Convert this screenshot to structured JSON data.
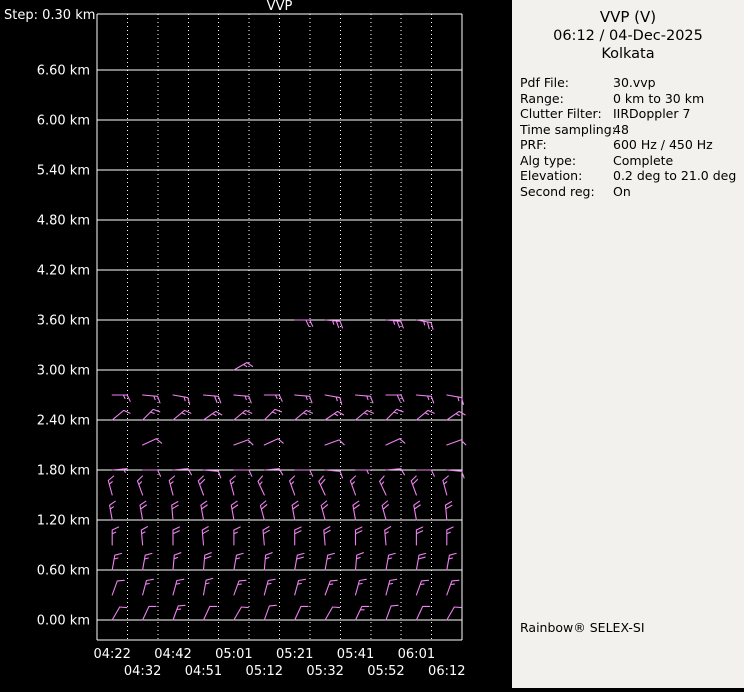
{
  "panel": {
    "title": "VVP (V)",
    "datetime": "06:12 / 04-Dec-2025",
    "site": "Kolkata",
    "params": [
      {
        "label": "Pdf File:",
        "value": "30.vvp"
      },
      {
        "label": "Range:",
        "value": "0 km to 30 km"
      },
      {
        "label": "Clutter Filter:",
        "value": "IIRDoppler 7"
      },
      {
        "label": "Time sampling:",
        "value": "48"
      },
      {
        "label": "PRF:",
        "value": "600 Hz / 450 Hz"
      },
      {
        "label": "Alg type:",
        "value": "Complete"
      },
      {
        "label": "Elevation:",
        "value": "0.2 deg to 21.0 deg"
      },
      {
        "label": "Second reg:",
        "value": "On"
      }
    ],
    "footer": "Rainbow® SELEX-SI"
  },
  "colors": {
    "chart_background": "#000000",
    "panel_background": "#f2f1ee",
    "grid": "#ffffff",
    "axis_text": "#ffffff",
    "barb": "#ee82ee",
    "panel_text": "#000000"
  },
  "chart_data": {
    "type": "scatter",
    "subtype": "wind-barb time-height profile (VVP)",
    "title": "VVP",
    "step_label": "Step: 0.30 km",
    "x_tick_labels": [
      "04:22",
      "04:32",
      "04:42",
      "04:51",
      "05:01",
      "05:12",
      "05:21",
      "05:32",
      "05:41",
      "05:52",
      "06:01",
      "06:12"
    ],
    "y_tick_labels": [
      "0.00 km",
      "0.60 km",
      "1.20 km",
      "1.80 km",
      "2.40 km",
      "3.00 km",
      "3.60 km",
      "4.20 km",
      "4.80 km",
      "5.40 km",
      "6.00 km",
      "6.60 km"
    ],
    "y_tick_values_km": [
      0,
      0.6,
      1.2,
      1.8,
      2.4,
      3.0,
      3.6,
      4.2,
      4.8,
      5.4,
      6.0,
      6.6
    ],
    "y_step_km": 0.3,
    "y_range_km": [
      -0.25,
      7.25
    ],
    "grid": true,
    "legend": "none",
    "background": "#000000",
    "grid_color": "#ffffff",
    "barb_color": "#ee82ee",
    "barb_note": "entries are [time_index, height_km, wind_from_direction_deg, speed_kt]; values estimated from plotted barbs",
    "barbs": [
      [
        0,
        0,
        30,
        10
      ],
      [
        0,
        0.3,
        20,
        10
      ],
      [
        0,
        0.6,
        10,
        15
      ],
      [
        0,
        0.9,
        0,
        15
      ],
      [
        0,
        1.2,
        350,
        15
      ],
      [
        0,
        1.5,
        345,
        15
      ],
      [
        0,
        1.8,
        85,
        5
      ],
      [
        0,
        2.4,
        50,
        10
      ],
      [
        0,
        2.7,
        90,
        15
      ],
      [
        1,
        0,
        25,
        10
      ],
      [
        1,
        0.3,
        15,
        15
      ],
      [
        1,
        0.6,
        10,
        15
      ],
      [
        1,
        0.9,
        355,
        15
      ],
      [
        1,
        1.2,
        350,
        20
      ],
      [
        1,
        1.5,
        340,
        15
      ],
      [
        1,
        1.8,
        90,
        10
      ],
      [
        1,
        2.1,
        65,
        10
      ],
      [
        1,
        2.4,
        45,
        15
      ],
      [
        1,
        2.7,
        95,
        15
      ],
      [
        2,
        0,
        20,
        15
      ],
      [
        2,
        0.3,
        15,
        15
      ],
      [
        2,
        0.6,
        5,
        15
      ],
      [
        2,
        0.9,
        0,
        20
      ],
      [
        2,
        1.2,
        355,
        20
      ],
      [
        2,
        1.5,
        345,
        15
      ],
      [
        2,
        1.8,
        85,
        10
      ],
      [
        2,
        2.4,
        50,
        15
      ],
      [
        2,
        2.7,
        100,
        15
      ],
      [
        3,
        0,
        25,
        10
      ],
      [
        3,
        0.3,
        10,
        15
      ],
      [
        3,
        0.6,
        5,
        20
      ],
      [
        3,
        0.9,
        355,
        20
      ],
      [
        3,
        1.2,
        350,
        20
      ],
      [
        3,
        1.5,
        340,
        20
      ],
      [
        3,
        1.8,
        95,
        10
      ],
      [
        3,
        2.4,
        55,
        15
      ],
      [
        3,
        2.7,
        95,
        20
      ],
      [
        4,
        0,
        30,
        10
      ],
      [
        4,
        0.3,
        20,
        15
      ],
      [
        4,
        0.6,
        10,
        15
      ],
      [
        4,
        0.9,
        0,
        15
      ],
      [
        4,
        1.2,
        350,
        20
      ],
      [
        4,
        1.5,
        345,
        15
      ],
      [
        4,
        1.8,
        90,
        10
      ],
      [
        4,
        2.1,
        70,
        10
      ],
      [
        4,
        2.4,
        50,
        15
      ],
      [
        4,
        2.7,
        95,
        15
      ],
      [
        4,
        3,
        60,
        15
      ],
      [
        5,
        0,
        20,
        10
      ],
      [
        5,
        0.3,
        15,
        15
      ],
      [
        5,
        0.6,
        5,
        15
      ],
      [
        5,
        0.9,
        355,
        20
      ],
      [
        5,
        1.2,
        345,
        20
      ],
      [
        5,
        1.5,
        335,
        15
      ],
      [
        5,
        1.8,
        85,
        10
      ],
      [
        5,
        2.1,
        65,
        10
      ],
      [
        5,
        2.4,
        45,
        15
      ],
      [
        5,
        2.7,
        90,
        15
      ],
      [
        6,
        0,
        25,
        10
      ],
      [
        6,
        0.3,
        15,
        15
      ],
      [
        6,
        0.6,
        10,
        20
      ],
      [
        6,
        0.9,
        0,
        20
      ],
      [
        6,
        1.2,
        350,
        20
      ],
      [
        6,
        1.5,
        340,
        15
      ],
      [
        6,
        1.8,
        90,
        10
      ],
      [
        6,
        2.4,
        50,
        15
      ],
      [
        6,
        2.7,
        95,
        15
      ],
      [
        6,
        3.6,
        90,
        20
      ],
      [
        7,
        0,
        30,
        10
      ],
      [
        7,
        0.3,
        20,
        15
      ],
      [
        7,
        0.6,
        10,
        15
      ],
      [
        7,
        0.9,
        355,
        20
      ],
      [
        7,
        1.2,
        345,
        20
      ],
      [
        7,
        1.5,
        335,
        20
      ],
      [
        7,
        1.8,
        95,
        10
      ],
      [
        7,
        2.1,
        70,
        10
      ],
      [
        7,
        2.4,
        55,
        15
      ],
      [
        7,
        2.7,
        100,
        15
      ],
      [
        7,
        3.6,
        95,
        25
      ],
      [
        8,
        0,
        25,
        15
      ],
      [
        8,
        0.3,
        15,
        15
      ],
      [
        8,
        0.6,
        5,
        15
      ],
      [
        8,
        0.9,
        0,
        20
      ],
      [
        8,
        1.2,
        350,
        20
      ],
      [
        8,
        1.5,
        340,
        15
      ],
      [
        8,
        1.8,
        90,
        5
      ],
      [
        8,
        2.4,
        50,
        15
      ],
      [
        8,
        2.7,
        95,
        15
      ],
      [
        9,
        0,
        20,
        10
      ],
      [
        9,
        0.3,
        15,
        15
      ],
      [
        9,
        0.6,
        10,
        15
      ],
      [
        9,
        0.9,
        355,
        15
      ],
      [
        9,
        1.2,
        345,
        20
      ],
      [
        9,
        1.5,
        335,
        15
      ],
      [
        9,
        1.8,
        85,
        10
      ],
      [
        9,
        2.1,
        65,
        10
      ],
      [
        9,
        2.4,
        45,
        15
      ],
      [
        9,
        2.7,
        90,
        20
      ],
      [
        9,
        3.6,
        95,
        25
      ],
      [
        10,
        0,
        25,
        10
      ],
      [
        10,
        0.3,
        20,
        15
      ],
      [
        10,
        0.6,
        10,
        20
      ],
      [
        10,
        0.9,
        0,
        20
      ],
      [
        10,
        1.2,
        350,
        20
      ],
      [
        10,
        1.5,
        340,
        20
      ],
      [
        10,
        1.8,
        90,
        10
      ],
      [
        10,
        2.4,
        50,
        15
      ],
      [
        10,
        2.7,
        95,
        15
      ],
      [
        10,
        3.6,
        100,
        25
      ],
      [
        11,
        0,
        30,
        10
      ],
      [
        11,
        0.3,
        20,
        15
      ],
      [
        11,
        0.6,
        10,
        15
      ],
      [
        11,
        0.9,
        0,
        15
      ],
      [
        11,
        1.2,
        355,
        20
      ],
      [
        11,
        1.5,
        345,
        15
      ],
      [
        11,
        1.8,
        95,
        10
      ],
      [
        11,
        2.1,
        70,
        10
      ],
      [
        11,
        2.4,
        55,
        15
      ],
      [
        11,
        2.7,
        100,
        15
      ]
    ]
  }
}
